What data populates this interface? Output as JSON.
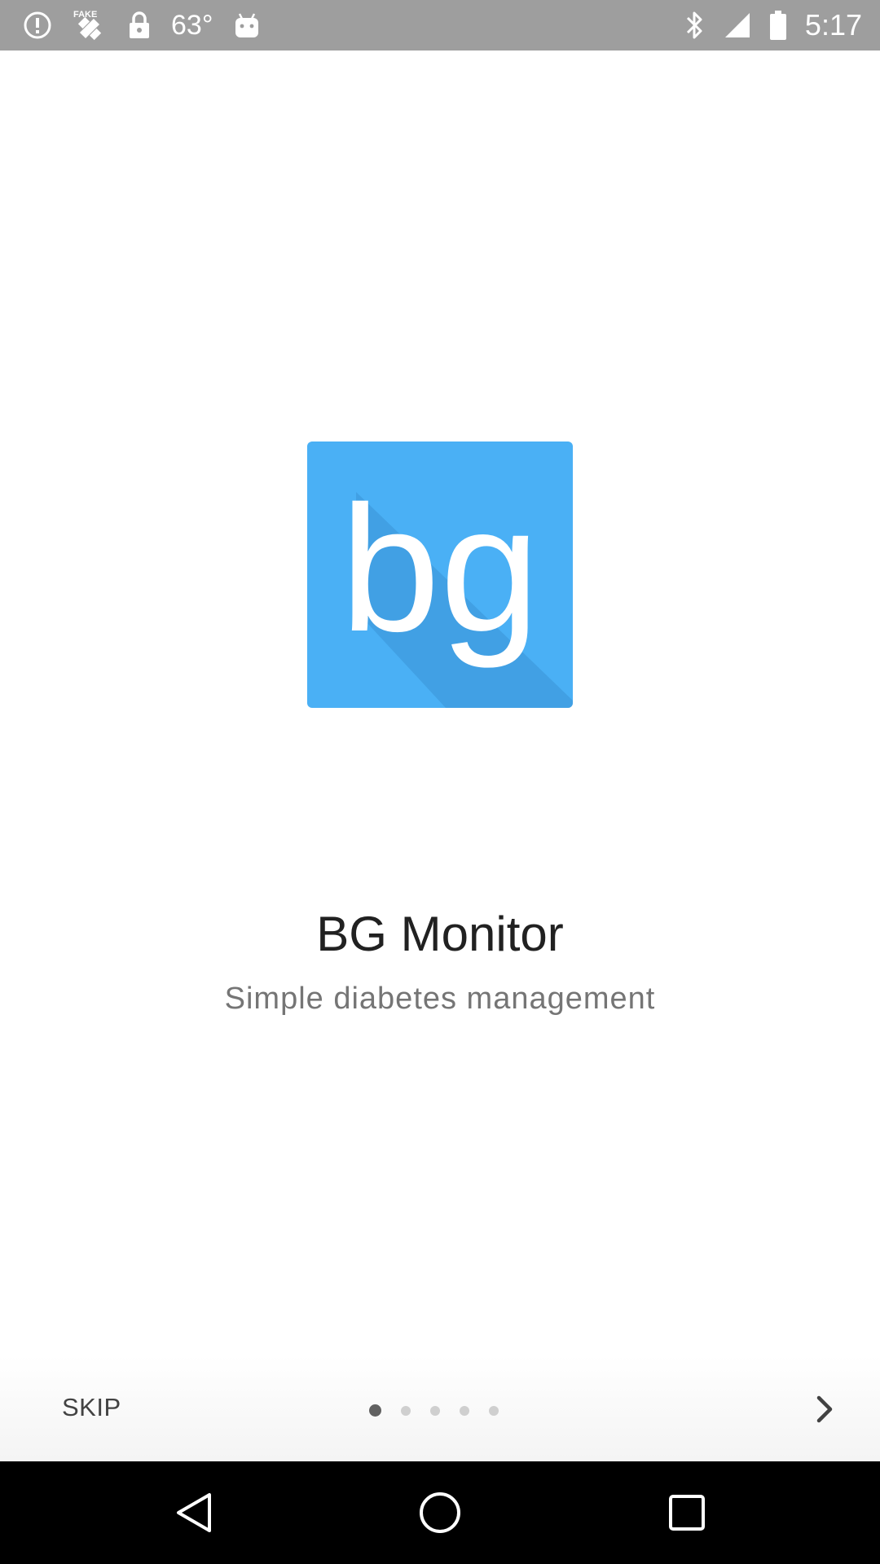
{
  "status_bar": {
    "temperature": "63°",
    "time": "5:17",
    "icons": [
      "alert-circle-icon",
      "fake-gps-icon",
      "lock-icon",
      "android-icon",
      "bluetooth-icon",
      "signal-icon",
      "battery-icon"
    ]
  },
  "app": {
    "logo_text": "bg",
    "logo_color": "#4ab0f5",
    "logo_shadow_color": "#3b93d6",
    "title": "BG Monitor",
    "subtitle": "Simple diabetes management"
  },
  "pager": {
    "skip_label": "SKIP",
    "page_count": 5,
    "current_page": 1,
    "next_icon": "chevron-right-icon"
  },
  "nav_bar": {
    "icons": [
      "back-icon",
      "home-icon",
      "recents-icon"
    ]
  }
}
